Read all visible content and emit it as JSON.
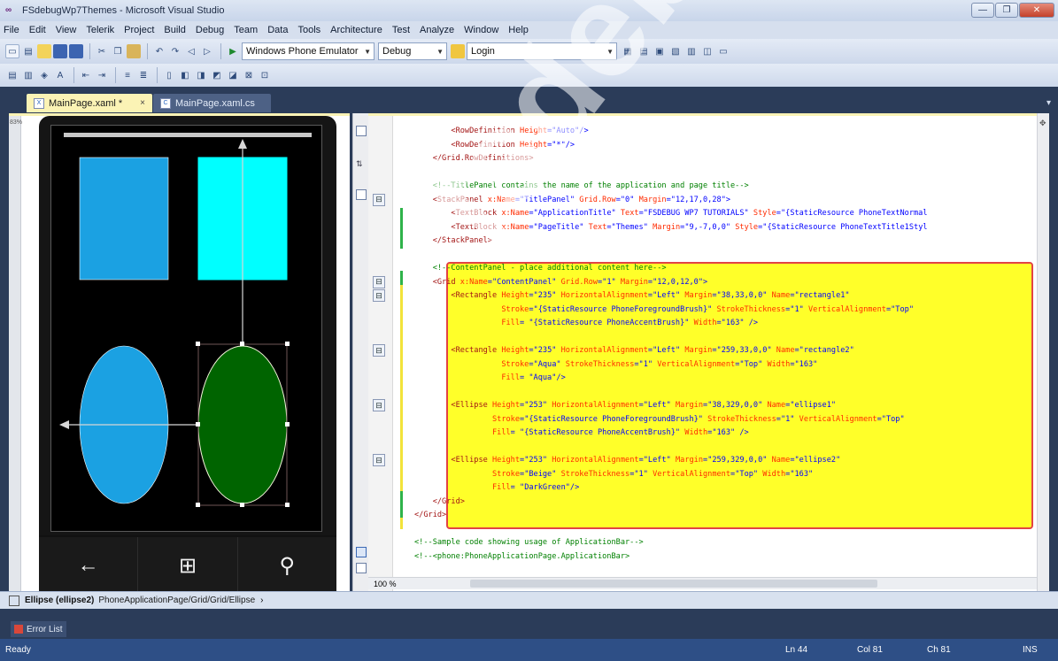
{
  "window": {
    "title": "FSdebugWp7Themes - Microsoft Visual Studio",
    "controls": [
      "—",
      "❐",
      "✕"
    ]
  },
  "menu": [
    "File",
    "Edit",
    "View",
    "Telerik",
    "Project",
    "Build",
    "Debug",
    "Team",
    "Data",
    "Tools",
    "Architecture",
    "Test",
    "Analyze",
    "Window",
    "Help"
  ],
  "toolbar": {
    "target": "Windows Phone Emulator",
    "config": "Debug",
    "find": "Login"
  },
  "tabs": [
    {
      "label": "MainPage.xaml",
      "modified": "*",
      "close": "×"
    },
    {
      "label": "MainPage.xaml.cs"
    }
  ],
  "design": {
    "zoom_label": "83%",
    "nav_buttons": [
      "←",
      "⊞",
      "⚲"
    ],
    "colors": {
      "rect1": "#1ba1e2",
      "rect2": "#00ffff",
      "ellipse1": "#1ba1e2",
      "ellipse2": "#006400"
    }
  },
  "code": {
    "lines": [
      [
        [
          "        ",
          ""
        ],
        [
          "<RowDefinition ",
          "tag"
        ],
        [
          "Height",
          "attr"
        ],
        [
          "=\"Auto\"/>",
          "val"
        ]
      ],
      [
        [
          "        ",
          ""
        ],
        [
          "<RowDefinition ",
          "tag"
        ],
        [
          "Height",
          "attr"
        ],
        [
          "=\"*\"/>",
          "val"
        ]
      ],
      [
        [
          "    ",
          ""
        ],
        [
          "</Grid.RowDefinitions>",
          "tag"
        ]
      ],
      [
        [
          "",
          ""
        ]
      ],
      [
        [
          "    ",
          ""
        ],
        [
          "<!--TitlePanel contains the name of the application and page title-->",
          "cmt"
        ]
      ],
      [
        [
          "    ",
          ""
        ],
        [
          "<StackPanel ",
          "tag"
        ],
        [
          "x:Name",
          "attr"
        ],
        [
          "=\"TitlePanel\" ",
          "val"
        ],
        [
          "Grid.Row",
          "attr"
        ],
        [
          "=\"0\" ",
          "val"
        ],
        [
          "Margin",
          "attr"
        ],
        [
          "=\"12,17,0,28\">",
          "val"
        ]
      ],
      [
        [
          "        ",
          ""
        ],
        [
          "<TextBlock ",
          "tag"
        ],
        [
          "x:Name",
          "attr"
        ],
        [
          "=\"ApplicationTitle\" ",
          "val"
        ],
        [
          "Text",
          "attr"
        ],
        [
          "=\"FSDEBUG WP7 TUTORIALS\" ",
          "val"
        ],
        [
          "Style",
          "attr"
        ],
        [
          "=\"{StaticResource PhoneTextNormal",
          "val"
        ]
      ],
      [
        [
          "        ",
          ""
        ],
        [
          "<TextBlock ",
          "tag"
        ],
        [
          "x:Name",
          "attr"
        ],
        [
          "=\"PageTitle\" ",
          "val"
        ],
        [
          "Text",
          "attr"
        ],
        [
          "=\"Themes\" ",
          "val"
        ],
        [
          "Margin",
          "attr"
        ],
        [
          "=\"9,-7,0,0\" ",
          "val"
        ],
        [
          "Style",
          "attr"
        ],
        [
          "=\"{StaticResource PhoneTextTitle1Styl",
          "val"
        ]
      ],
      [
        [
          "    ",
          ""
        ],
        [
          "</StackPanel>",
          "tag"
        ]
      ],
      [
        [
          "",
          ""
        ]
      ],
      [
        [
          "    ",
          ""
        ],
        [
          "<!--ContentPanel - place additional content here-->",
          "cmt"
        ]
      ],
      [
        [
          "    ",
          ""
        ],
        [
          "<Grid ",
          "tag"
        ],
        [
          "x:Name",
          "attr"
        ],
        [
          "=\"ContentPanel\" ",
          "val"
        ],
        [
          "Grid.Row",
          "attr"
        ],
        [
          "=\"1\" ",
          "val"
        ],
        [
          "Margin",
          "attr"
        ],
        [
          "=\"12,0,12,0\">",
          "val"
        ]
      ],
      [
        [
          "        ",
          ""
        ],
        [
          "<Rectangle ",
          "tag"
        ],
        [
          "Height",
          "attr"
        ],
        [
          "=\"235\" ",
          "val"
        ],
        [
          "HorizontalAlignment",
          "attr"
        ],
        [
          "=\"Left\" ",
          "val"
        ],
        [
          "Margin",
          "attr"
        ],
        [
          "=\"38,33,0,0\" ",
          "val"
        ],
        [
          "Name",
          "attr"
        ],
        [
          "=\"rectangle1\"",
          "val"
        ]
      ],
      [
        [
          "                   ",
          ""
        ],
        [
          "Stroke",
          "attr"
        ],
        [
          "=\"{StaticResource PhoneForegroundBrush}\" ",
          "val"
        ],
        [
          "StrokeThickness",
          "attr"
        ],
        [
          "=\"1\" ",
          "val"
        ],
        [
          "VerticalAlignment",
          "attr"
        ],
        [
          "=\"Top\"",
          "val"
        ]
      ],
      [
        [
          "                   ",
          ""
        ],
        [
          "Fill",
          "attr"
        ],
        [
          "= \"{StaticResource PhoneAccentBrush}\" ",
          "val"
        ],
        [
          "Width",
          "attr"
        ],
        [
          "=\"163\" />",
          "val"
        ]
      ],
      [
        [
          "",
          ""
        ]
      ],
      [
        [
          "        ",
          ""
        ],
        [
          "<Rectangle ",
          "tag"
        ],
        [
          "Height",
          "attr"
        ],
        [
          "=\"235\" ",
          "val"
        ],
        [
          "HorizontalAlignment",
          "attr"
        ],
        [
          "=\"Left\" ",
          "val"
        ],
        [
          "Margin",
          "attr"
        ],
        [
          "=\"259,33,0,0\" ",
          "val"
        ],
        [
          "Name",
          "attr"
        ],
        [
          "=\"rectangle2\"",
          "val"
        ]
      ],
      [
        [
          "                   ",
          ""
        ],
        [
          "Stroke",
          "attr"
        ],
        [
          "=\"Aqua\" ",
          "val"
        ],
        [
          "StrokeThickness",
          "attr"
        ],
        [
          "=\"1\" ",
          "val"
        ],
        [
          "VerticalAlignment",
          "attr"
        ],
        [
          "=\"Top\" ",
          "val"
        ],
        [
          "Width",
          "attr"
        ],
        [
          "=\"163\"",
          "val"
        ]
      ],
      [
        [
          "                   ",
          ""
        ],
        [
          "Fill",
          "attr"
        ],
        [
          "= \"Aqua\"/>",
          "val"
        ]
      ],
      [
        [
          "",
          ""
        ]
      ],
      [
        [
          "        ",
          ""
        ],
        [
          "<Ellipse ",
          "tag"
        ],
        [
          "Height",
          "attr"
        ],
        [
          "=\"253\" ",
          "val"
        ],
        [
          "HorizontalAlignment",
          "attr"
        ],
        [
          "=\"Left\" ",
          "val"
        ],
        [
          "Margin",
          "attr"
        ],
        [
          "=\"38,329,0,0\" ",
          "val"
        ],
        [
          "Name",
          "attr"
        ],
        [
          "=\"ellipse1\"",
          "val"
        ]
      ],
      [
        [
          "                 ",
          ""
        ],
        [
          "Stroke",
          "attr"
        ],
        [
          "=\"{StaticResource PhoneForegroundBrush}\" ",
          "val"
        ],
        [
          "StrokeThickness",
          "attr"
        ],
        [
          "=\"1\" ",
          "val"
        ],
        [
          "VerticalAlignment",
          "attr"
        ],
        [
          "=\"Top\"",
          "val"
        ]
      ],
      [
        [
          "                 ",
          ""
        ],
        [
          "Fill",
          "attr"
        ],
        [
          "= \"{StaticResource PhoneAccentBrush}\" ",
          "val"
        ],
        [
          "Width",
          "attr"
        ],
        [
          "=\"163\" />",
          "val"
        ]
      ],
      [
        [
          "",
          ""
        ]
      ],
      [
        [
          "        ",
          ""
        ],
        [
          "<Ellipse ",
          "tag"
        ],
        [
          "Height",
          "attr"
        ],
        [
          "=\"253\" ",
          "val"
        ],
        [
          "HorizontalAlignment",
          "attr"
        ],
        [
          "=\"Left\" ",
          "val"
        ],
        [
          "Margin",
          "attr"
        ],
        [
          "=\"259,329,0,0\" ",
          "val"
        ],
        [
          "Name",
          "attr"
        ],
        [
          "=\"ellipse2\"",
          "val"
        ]
      ],
      [
        [
          "                 ",
          ""
        ],
        [
          "Stroke",
          "attr"
        ],
        [
          "=\"Beige\" ",
          "val"
        ],
        [
          "StrokeThickness",
          "attr"
        ],
        [
          "=\"1\" ",
          "val"
        ],
        [
          "VerticalAlignment",
          "attr"
        ],
        [
          "=\"Top\" ",
          "val"
        ],
        [
          "Width",
          "attr"
        ],
        [
          "=\"163\"",
          "val"
        ]
      ],
      [
        [
          "                 ",
          ""
        ],
        [
          "Fill",
          "attr"
        ],
        [
          "= \"DarkGreen\"/>",
          "val"
        ]
      ],
      [
        [
          "    ",
          ""
        ],
        [
          "</Grid>",
          "tag"
        ]
      ],
      [
        [
          "",
          ""
        ],
        [
          "</Grid>",
          "tag"
        ]
      ],
      [
        [
          "",
          ""
        ]
      ],
      [
        [
          "",
          ""
        ],
        [
          "<!--Sample code showing usage of ApplicationBar-->",
          "cmt"
        ]
      ],
      [
        [
          "",
          ""
        ],
        [
          "<!--<phone:PhoneApplicationPage.ApplicationBar>",
          "cmt"
        ]
      ]
    ]
  },
  "zoom": "100 %",
  "breadcrumb": {
    "element": "Ellipse (ellipse2)",
    "path": "PhoneApplicationPage/Grid/Grid/Ellipse",
    "arrow": "›"
  },
  "error_list": "Error List",
  "status": {
    "state": "Ready",
    "ln": "Ln 44",
    "col": "Col 81",
    "ch": "Ch 81",
    "mode": "INS"
  },
  "watermark": "fsdebug.net"
}
